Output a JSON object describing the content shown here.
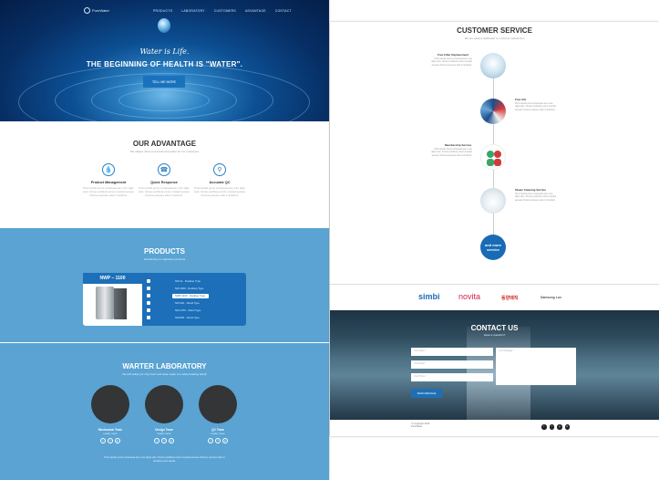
{
  "hero": {
    "logo_text": "PureWater",
    "nav": [
      "PRODUCTS",
      "LABORATORY",
      "CUSTOMERS",
      "ADVANTAGE",
      "CONTACT"
    ],
    "subtitle": "Water is Life.",
    "title": "THE BEGINNING OF HEALTH IS \"WATER\".",
    "button": "TELL ME MORE"
  },
  "advantage": {
    "title": "OUR ADVANTAGE",
    "subtitle": "We always strive to provide best water for our customers",
    "items": [
      {
        "icon": "water-drop-icon",
        "name": "Product Management",
        "desc": "Proin iaculis purus consequat sem cure digni ssim. Donec porttitora entum suscipit aenean rhoncus posuere odio in tincidunt."
      },
      {
        "icon": "headset-icon",
        "name": "Quick Response",
        "desc": "Proin iaculis purus consequat sem cure digni ssim. Donec porttitora entum suscipit aenean rhoncus posuere odio in tincidunt."
      },
      {
        "icon": "search-icon",
        "name": "Accurate QC",
        "desc": "Proin iaculis purus consequat sem cure digni ssim. Donec porttitora entum suscipit aenean rhoncus posuere odio in tincidunt."
      }
    ]
  },
  "products": {
    "title": "PRODUCTS",
    "subtitle": "Introducing our signature products",
    "featured": "NWP – 1100",
    "list": [
      "NW-11 - Desktop Type",
      "NW-1000 - Desktop Type",
      "NWP-1100 - Desktop Type",
      "NW-320 - Stand Type",
      "NW-1700 - Stand Type",
      "NW-800 - Stand Type"
    ],
    "selected_index": 2
  },
  "lab": {
    "title": "WARTER LABORATORY",
    "subtitle": "We will safely put only fresh and clean water in a wheel leading family",
    "members": [
      {
        "name": "Mechanical Team",
        "role": "Leader name"
      },
      {
        "name": "Design Team",
        "role": "Leader name"
      },
      {
        "name": "QC Team",
        "role": "Leader name"
      }
    ],
    "footer": "Proin iaculis purus consequat sem cure digni ssim. Donec porttitora entum suscipit aenean rhoncus posuere odio in tincidunt proin iaculis."
  },
  "service": {
    "title": "CUSTOMER SERVICE",
    "subtitle": "We are always dedicated to customer satisfaction",
    "items": [
      {
        "title": "Free Filter Replacement",
        "desc": "Proin iaculis purus consequat sem cure digni ssim. Donec porttitora entum suscipit aenean rhoncus posuere odio in tincidunt."
      },
      {
        "title": "Free A/S",
        "desc": "Proin iaculis purus consequat sem cure digni ssim. Donec porttitora entum suscipit aenean rhoncus posuere odio in tincidunt."
      },
      {
        "title": "Membership Service",
        "desc": "Proin iaculis purus consequat sem cure digni ssim. Donec porttitora entum suscipit aenean rhoncus posuere odio in tincidunt."
      },
      {
        "title": "Steam Cleaning Service",
        "desc": "Proin iaculis purus consequat sem cure digni ssim. Donec porttitora entum suscipit aenean rhoncus posuere odio in tincidunt."
      }
    ],
    "more": "and more service"
  },
  "partners": [
    "simbi",
    "novita",
    "동양매직",
    "Samsung Lux"
  ],
  "contact": {
    "title": "CONTACT US",
    "subtitle": "Have a question?",
    "name_ph": "Your Name *",
    "email_ph": "Your Email *",
    "phone_ph": "Your Phone *",
    "message_ph": "Your Message *",
    "button": "SEND MESSAGE"
  },
  "footer": {
    "copyright": "© Copyright 2015",
    "brand": "PureWater",
    "socials": [
      "f",
      "t",
      "g",
      "in"
    ]
  },
  "colors": {
    "accent": "#1c6fb8",
    "products_bg": "#5aa3d3"
  }
}
